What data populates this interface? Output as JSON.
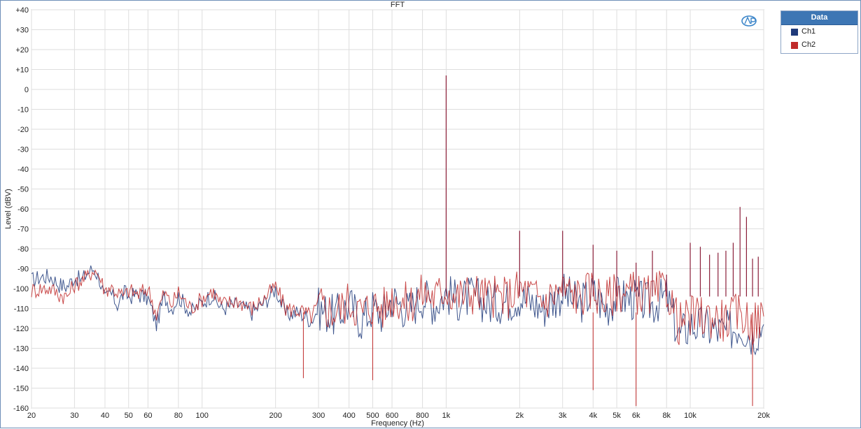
{
  "chart_data": {
    "type": "line",
    "title": "FFT",
    "xlabel": "Frequency (Hz)",
    "ylabel": "Level (dBV)",
    "x_scale": "log",
    "xlim": [
      20,
      20000
    ],
    "ylim": [
      -160,
      40
    ],
    "grid": true,
    "legend_position": "right",
    "x_ticks": [
      20,
      30,
      40,
      50,
      60,
      80,
      100,
      200,
      300,
      400,
      500,
      600,
      800,
      1000,
      2000,
      3000,
      4000,
      5000,
      6000,
      8000,
      10000,
      20000
    ],
    "x_tick_labels": [
      "20",
      "30",
      "40",
      "50",
      "60",
      "80",
      "100",
      "200",
      "300",
      "400",
      "500",
      "600",
      "800",
      "1k",
      "2k",
      "3k",
      "4k",
      "5k",
      "6k",
      "8k",
      "10k",
      "20k"
    ],
    "y_ticks": [
      40,
      30,
      20,
      10,
      0,
      -10,
      -20,
      -30,
      -40,
      -50,
      -60,
      -70,
      -80,
      -90,
      -100,
      -110,
      -120,
      -130,
      -140,
      -150,
      -160
    ],
    "y_tick_labels": [
      "+40",
      "+30",
      "+20",
      "+10",
      "0",
      "-10",
      "-20",
      "-30",
      "-40",
      "-50",
      "-60",
      "-70",
      "-80",
      "-90",
      "-100",
      "-110",
      "-120",
      "-130",
      "-140",
      "-150",
      "-160"
    ],
    "legend_title": "Data",
    "series": [
      {
        "name": "Ch1",
        "color": "#1f3a7a",
        "x": [
          20,
          22,
          24,
          26,
          28,
          30,
          32,
          34,
          36,
          38,
          40,
          42,
          45,
          48,
          50,
          55,
          60,
          65,
          70,
          75,
          80,
          90,
          100,
          110,
          120,
          140,
          160,
          180,
          200,
          220,
          250,
          280,
          300,
          350,
          400,
          450,
          500,
          550,
          600,
          700,
          800,
          900,
          1000,
          1100,
          1300,
          1500,
          1800,
          2000,
          2500,
          3000,
          3500,
          4000,
          4500,
          5000,
          6000,
          7000,
          8000,
          9000,
          10000,
          12000,
          14000,
          16000,
          18000,
          20000
        ],
        "values": [
          -96,
          -94,
          -94,
          -98,
          -99,
          -94,
          -96,
          -92,
          -90,
          -95,
          -106,
          -102,
          -108,
          -102,
          -104,
          -103,
          -105,
          -118,
          -104,
          -110,
          -104,
          -112,
          -107,
          -103,
          -110,
          -108,
          -112,
          -107,
          -100,
          -113,
          -112,
          -116,
          -110,
          -114,
          -108,
          -116,
          -110,
          -113,
          -105,
          -111,
          -104,
          -108,
          -102,
          -106,
          -104,
          -108,
          -106,
          -104,
          -110,
          -102,
          -108,
          -102,
          -110,
          -104,
          -106,
          -108,
          -104,
          -124,
          -118,
          -120,
          -122,
          -118,
          -124,
          -118
        ]
      },
      {
        "name": "Ch2",
        "color": "#c02a2a",
        "x": [
          20,
          22,
          24,
          26,
          28,
          30,
          32,
          34,
          36,
          38,
          40,
          42,
          45,
          48,
          50,
          55,
          60,
          65,
          70,
          75,
          80,
          90,
          100,
          110,
          120,
          140,
          160,
          180,
          200,
          220,
          250,
          280,
          300,
          350,
          400,
          450,
          500,
          550,
          600,
          700,
          800,
          900,
          1000,
          1100,
          1300,
          1500,
          1800,
          2000,
          2500,
          3000,
          3500,
          4000,
          4500,
          5000,
          6000,
          7000,
          8000,
          9000,
          10000,
          12000,
          14000,
          16000,
          18000,
          20000
        ],
        "values": [
          -101,
          -100,
          -100,
          -103,
          -104,
          -98,
          -96,
          -94,
          -90,
          -94,
          -101,
          -99,
          -102,
          -104,
          -101,
          -103,
          -100,
          -113,
          -102,
          -108,
          -102,
          -110,
          -105,
          -101,
          -108,
          -106,
          -110,
          -105,
          -99,
          -110,
          -111,
          -114,
          -108,
          -112,
          -106,
          -112,
          -108,
          -110,
          -104,
          -108,
          -102,
          -104,
          -100,
          -104,
          -102,
          -104,
          -104,
          -100,
          -106,
          -100,
          -104,
          -100,
          -106,
          -101,
          -102,
          -104,
          -100,
          -118,
          -114,
          -114,
          -116,
          -112,
          -118,
          -114
        ]
      }
    ],
    "peaks": {
      "x": [
        1000,
        2000,
        3000,
        4000,
        5000,
        6000,
        7000,
        8000,
        10000,
        11000,
        12000,
        13000,
        14000,
        15000,
        16000,
        17000,
        18000,
        19000
      ],
      "values": [
        7,
        -71,
        -71,
        -78,
        -81,
        -87,
        -81,
        -93,
        -77,
        -79,
        -83,
        -82,
        -81,
        -77,
        -59,
        -64,
        -85,
        -84
      ],
      "notches": [
        [
          260,
          -145
        ],
        [
          500,
          -146
        ],
        [
          4000,
          -151
        ],
        [
          6000,
          -159
        ],
        [
          18000,
          -159
        ]
      ]
    }
  }
}
